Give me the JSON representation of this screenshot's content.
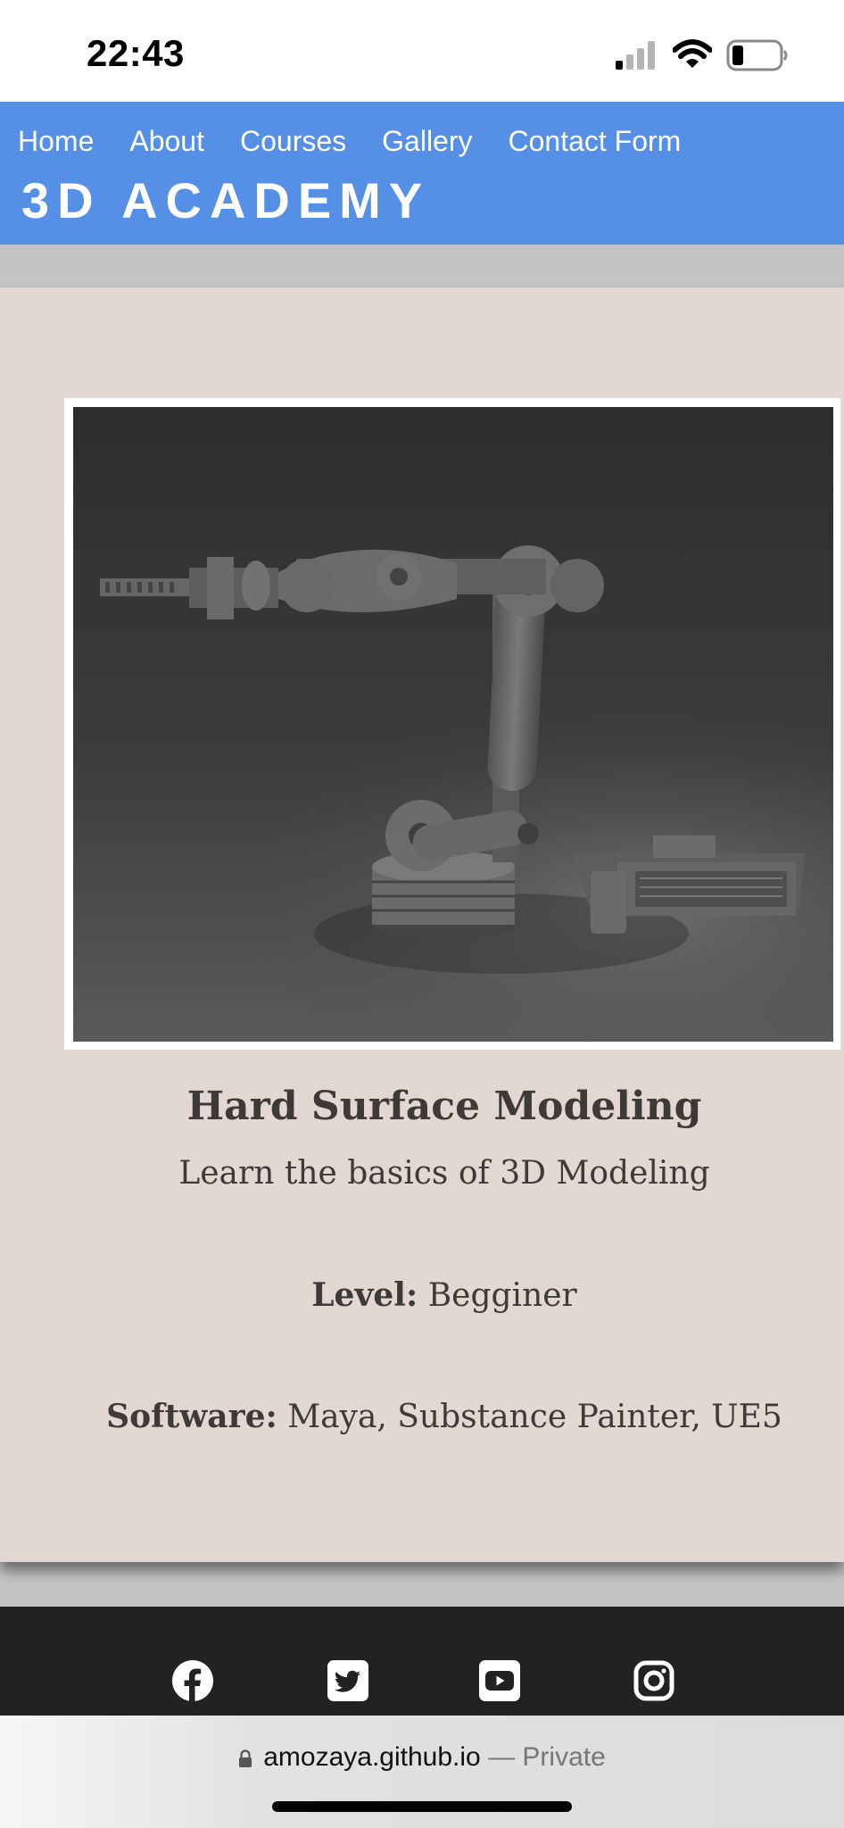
{
  "status_bar": {
    "time": "22:43",
    "icons": [
      "signal-icon",
      "wifi-icon",
      "battery-icon"
    ]
  },
  "header": {
    "nav": [
      {
        "label": "Home"
      },
      {
        "label": "About"
      },
      {
        "label": "Courses"
      },
      {
        "label": "Gallery"
      },
      {
        "label": "Contact Form"
      }
    ],
    "brand": "3D ACADEMY",
    "color": "#5590e6"
  },
  "course": {
    "image": "robot-arm-render-image",
    "title": "Hard Surface Modeling",
    "subtitle": "Learn the basics of 3D Modeling",
    "level_label": "Level:",
    "level_value": "Begginer",
    "software_label": "Software:",
    "software_value": "Maya, Substance Painter, UE5",
    "background": "#e2d7d1"
  },
  "footer": {
    "social_icons": [
      "facebook-icon",
      "twitter-icon",
      "youtube-icon",
      "instagram-icon"
    ],
    "background": "#222222"
  },
  "browser": {
    "domain": "amozaya.github.io",
    "separator": "—",
    "privacy": "Private"
  }
}
